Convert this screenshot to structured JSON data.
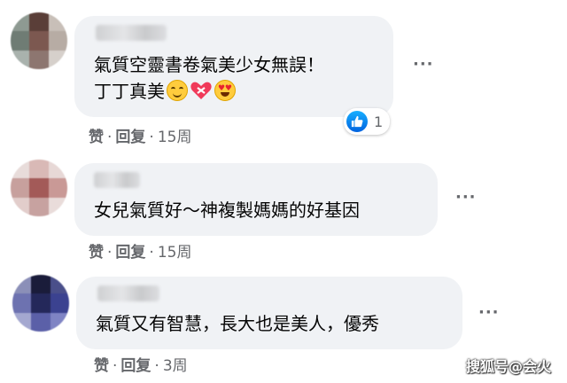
{
  "comments": [
    {
      "text_line1": "氣質空靈書卷氣美少女無誤！",
      "text_line2": "丁丁真美",
      "emojis": [
        "smiling-face-icon",
        "mending-heart-icon",
        "heart-eyes-icon"
      ],
      "like_label": "赞",
      "reply_label": "回复",
      "time": "15周",
      "reaction_count": "1"
    },
    {
      "text": "女兒氣質好～神複製媽媽的好基因",
      "like_label": "赞",
      "reply_label": "回复",
      "time": "15周"
    },
    {
      "text": "氣質又有智慧，長大也是美人，優秀",
      "like_label": "赞",
      "reply_label": "回复",
      "time": "3周"
    }
  ],
  "more_label": "···",
  "separator": "·",
  "watermark": "搜狐号@会火",
  "colors": {
    "bubble": "#f0f2f5",
    "meta_text": "#65676b",
    "like_blue": "#1877f2"
  }
}
